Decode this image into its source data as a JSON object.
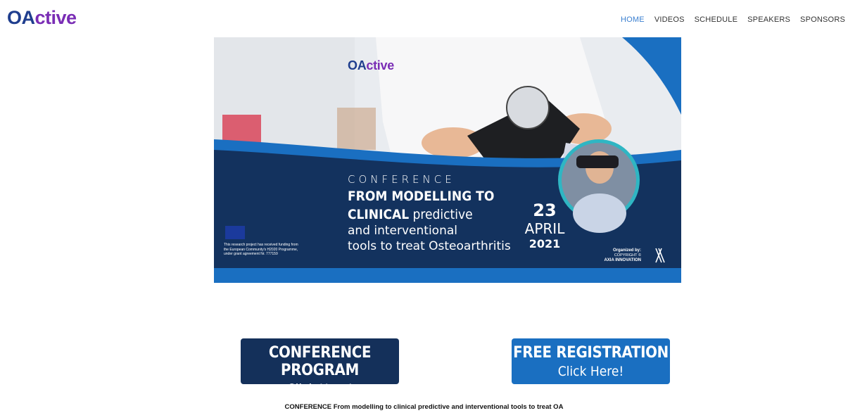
{
  "header": {
    "logo_part1": "OA",
    "logo_part2": "ctive",
    "nav": [
      {
        "label": "HOME",
        "active": true
      },
      {
        "label": "VIDEOS"
      },
      {
        "label": "SCHEDULE"
      },
      {
        "label": "SPEAKERS"
      },
      {
        "label": "SPONSORS"
      }
    ]
  },
  "banner": {
    "logo_part1": "OA",
    "logo_part2": "ctive",
    "kicker": "CONFERENCE",
    "line1": "FROM MODELLING TO",
    "line2_bold": "CLINICAL",
    "line2_rest": " predictive",
    "line3": "and interventional",
    "line4": "tools to treat Osteoarthritis",
    "day": "23",
    "month": "APRIL",
    "year": "2021",
    "eu_text": "This research project has received funding from the European Community's H2020 Programme, under grant agreement Nr. 777159",
    "organized_by": "Organized by:",
    "copyright": "COPYRIGHT ©",
    "organizer": "AXIA INNOVATION"
  },
  "buttons": {
    "program_title": "CONFERENCE PROGRAM",
    "program_sub": "Click Here!",
    "register_title": "FREE REGISTRATION",
    "register_sub": "Click Here!"
  },
  "footer": {
    "caption": "CONFERENCE From modelling to clinical predictive and interventional tools to treat OA"
  },
  "colors": {
    "brand_blue": "#1f3e8e",
    "brand_purple": "#7a2db5",
    "nav_active": "#3a7fd0",
    "program_button": "#14305a",
    "register_button": "#1a6fc1"
  }
}
